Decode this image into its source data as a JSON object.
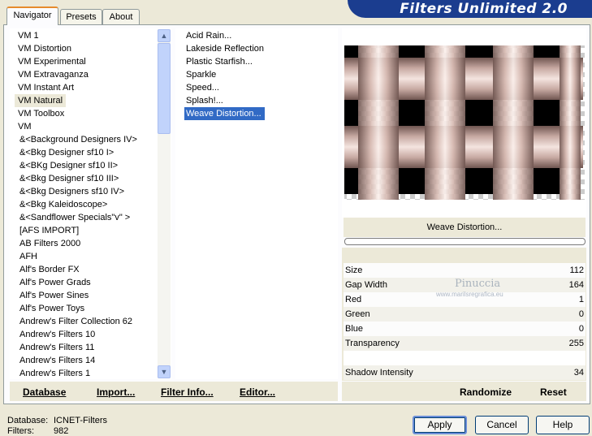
{
  "tabs": [
    "Navigator",
    "Presets",
    "About"
  ],
  "banner_title": "Filters Unlimited 2.0",
  "categories": [
    "VM 1",
    "VM Distortion",
    "VM Experimental",
    "VM Extravaganza",
    "VM Instant Art",
    "VM Natural",
    "VM Toolbox",
    "VM",
    "&<Background Designers IV>",
    "&<Bkg Designer sf10 I>",
    "&<BKg Designer sf10 II>",
    "&<Bkg Designer sf10 III>",
    "&<Bkg Designers sf10 IV>",
    "&<Bkg Kaleidoscope>",
    "&<Sandflower Specials\"v\" >",
    "[AFS IMPORT]",
    "AB Filters 2000",
    "AFH",
    "Alf's Border FX",
    "Alf's Power Grads",
    "Alf's Power Sines",
    "Alf's Power Toys",
    "Andrew's Filter Collection 62",
    "Andrew's Filters 10",
    "Andrew's Filters 11",
    "Andrew's Filters 14",
    "Andrew's Filters 1"
  ],
  "selected_category": "VM Natural",
  "filters": [
    "Acid Rain...",
    "Lakeside Reflection",
    "Plastic Starfish...",
    "Sparkle",
    "Speed...",
    "Splash!...",
    "Weave Distortion..."
  ],
  "selected_filter": "Weave Distortion...",
  "preview": {
    "filter_name": "Weave Distortion...",
    "progress": 0,
    "watermark": "Pinuccia",
    "watermark_url": "www.marilsregrafica.eu"
  },
  "params": [
    {
      "label": "Size",
      "value": "112"
    },
    {
      "label": "Gap Width",
      "value": "164"
    },
    {
      "label": "Red",
      "value": "1"
    },
    {
      "label": "Green",
      "value": "0"
    },
    {
      "label": "Blue",
      "value": "0"
    },
    {
      "label": "Transparency",
      "value": "255"
    },
    {
      "label": "",
      "value": ""
    },
    {
      "label": "Shadow Intensity",
      "value": "34"
    }
  ],
  "bottom_buttons": {
    "database": "Database",
    "import": "Import...",
    "filter_info": "Filter Info...",
    "editor": "Editor...",
    "randomize": "Randomize",
    "reset": "Reset"
  },
  "status": {
    "database_label": "Database:",
    "database_value": "ICNET-Filters",
    "filters_label": "Filters:",
    "filters_value": "982"
  },
  "dialog_buttons": {
    "apply": "Apply",
    "cancel": "Cancel",
    "help": "Help"
  },
  "colors": {
    "selection": "#316ac5",
    "banner": "#1b3d8f",
    "window": "#ece9d8"
  }
}
